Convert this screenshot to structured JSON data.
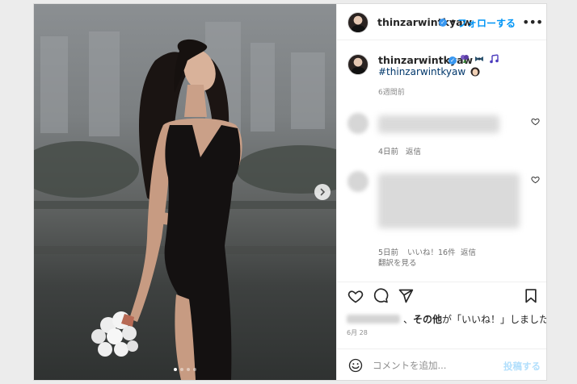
{
  "post": {
    "username": "thinzarwintkyaw",
    "verified": true,
    "header": {
      "separator": "•",
      "follow_label": "フォローする",
      "more_label": "•••"
    },
    "caption": {
      "username": "thinzarwintkyaw",
      "emoji_icons": [
        "bouquet-icon",
        "ribbon-icon",
        "music-notes-icon"
      ],
      "hashtag": "#thinzarwintkyaw",
      "hashtag_emoji_icon": "woman-face-icon",
      "time_ago": "6週間前"
    },
    "comments": [
      {
        "time_ago": "4日前",
        "reply_label": "返信"
      },
      {
        "time_ago": "5日前",
        "likes_label": "いいね！16件",
        "reply_label": "返信",
        "translate_label": "翻訳を見る"
      }
    ],
    "actions": {
      "icons": [
        "heart-icon",
        "comment-icon",
        "share-icon",
        "bookmark-icon"
      ]
    },
    "likes": {
      "separator": "、",
      "others_label": "その他",
      "suffix": "が「いいね！」しました"
    },
    "date": "6月 28",
    "comment_box": {
      "placeholder": "コメントを追加...",
      "post_label": "投稿する"
    },
    "carousel": {
      "slide_count": 4,
      "current_slide": 1
    }
  },
  "colors": {
    "link_blue": "#0095f6",
    "hashtag_blue": "#00376b",
    "verified_blue": "#3897f0",
    "post_button_disabled": "#b2dffc",
    "secondary_text": "#737373"
  }
}
